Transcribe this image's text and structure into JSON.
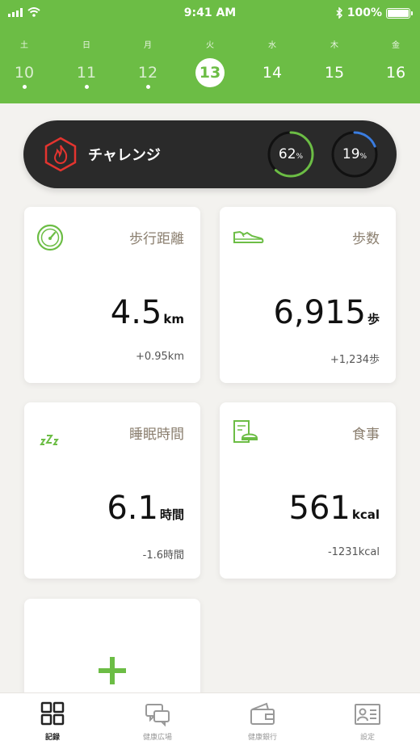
{
  "status_bar": {
    "time": "9:41 AM",
    "battery": "100%"
  },
  "week": [
    {
      "weekday": "土",
      "date": "10",
      "has_record": true
    },
    {
      "weekday": "日",
      "date": "11",
      "has_record": true
    },
    {
      "weekday": "月",
      "date": "12",
      "has_record": true
    },
    {
      "weekday": "火",
      "date": "13",
      "selected": true
    },
    {
      "weekday": "水",
      "date": "14"
    },
    {
      "weekday": "木",
      "date": "15"
    },
    {
      "weekday": "金",
      "date": "16"
    }
  ],
  "challenge": {
    "label": "チャレンジ",
    "rings": [
      {
        "value": "62",
        "unit": "%",
        "progress": 0.62,
        "color": "#6cbd45"
      },
      {
        "value": "19",
        "unit": "%",
        "progress": 0.19,
        "color": "#3b7de0"
      }
    ]
  },
  "cards": {
    "distance": {
      "title": "歩行距離",
      "value": "4.5",
      "unit": "km",
      "diff": "+0.95km",
      "icon": "speedometer-icon"
    },
    "steps": {
      "title": "歩数",
      "value": "6,915",
      "unit": "歩",
      "diff": "+1,234歩",
      "icon": "sneaker-icon"
    },
    "sleep": {
      "title": "睡眠時間",
      "value": "6.1",
      "unit": "時間",
      "diff": "-1.6時間",
      "icon": "zzz-icon"
    },
    "meal": {
      "title": "食事",
      "value": "561",
      "unit": "kcal",
      "diff": "-1231kcal",
      "icon": "meal-icon"
    }
  },
  "tabs": [
    {
      "label": "記録",
      "icon": "grid-icon",
      "active": true
    },
    {
      "label": "健康広場",
      "icon": "chat-icon"
    },
    {
      "label": "健康銀行",
      "icon": "wallet-icon"
    },
    {
      "label": "設定",
      "icon": "id-card-icon"
    }
  ],
  "colors": {
    "accent": "#6cbd45",
    "dark": "#2a2a2a",
    "blue": "#3b7de0"
  }
}
